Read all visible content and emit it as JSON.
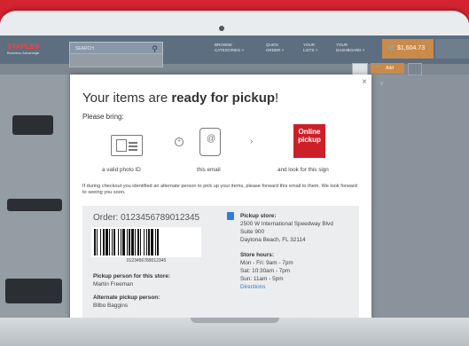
{
  "site": {
    "logo": "STAPLES",
    "logo_sub": "Business Advantage",
    "search_placeholder": "SEARCH",
    "nav": [
      {
        "top": "BROWSE",
        "bottom": "CATEGORIES"
      },
      {
        "top": "QUICK",
        "bottom": "ORDER"
      },
      {
        "top": "YOUR",
        "bottom": "LISTS"
      },
      {
        "top": "YOUR",
        "bottom": "DASHBOARD"
      }
    ],
    "cart_total": "$1,604.73",
    "add_label": "Add"
  },
  "modal": {
    "title_prefix": "Your items are ",
    "title_bold": "ready for pickup",
    "title_suffix": "!",
    "bring_label": "Please bring:",
    "sign_text": "Online pickup",
    "captions": {
      "id": "a valid photo ID",
      "email": "this email",
      "sign": "and look for this sign"
    },
    "note": "If during checkout you identified an alternate person to pick up your items, please forward this email to them. We look forward to seeing you soon.",
    "order_label": "Order: 0123456789012345",
    "barcode_number": "0123456789012345",
    "pickup_person_label": "Pickup person for this store:",
    "pickup_person_name": "Martin Freeman",
    "alt_person_label": "Alternate pickup person:",
    "alt_person_name": "Bilbo Baggins",
    "store_label": "Pickup store:",
    "store_address": [
      "2500 W International Speedway Blvd",
      "Suite 900",
      "Daytona Beach, FL 32114"
    ],
    "hours_label": "Store hours:",
    "hours": [
      "Mon - Fri: 9am - 7pm",
      "Sat: 10:30am - 7pm",
      "Sun: 11am - 5pm"
    ],
    "directions_label": "Directions"
  },
  "colors": {
    "brand_red": "#cc1f29",
    "link_blue": "#2d7fd1",
    "cart_orange": "#c98a4a"
  }
}
